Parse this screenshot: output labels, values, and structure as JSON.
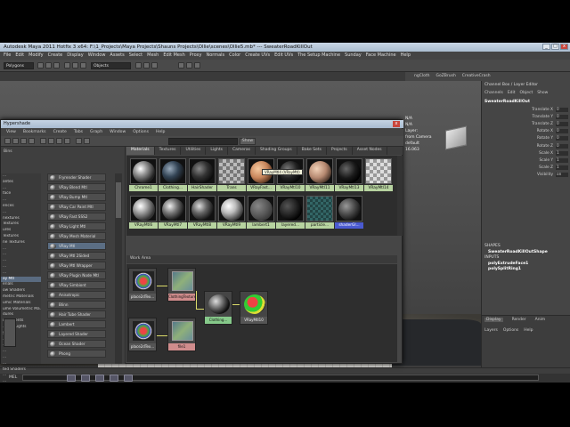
{
  "window": {
    "title": "Autodesk Maya 2011 Hotfix 3 x64: F:\\1_Projects\\Maya Projects\\Shauns Projects\\Ollie\\scenes\\Ollie5.mb* --- SweaterRoadKillOut",
    "buttons": [
      "_",
      "□",
      "x"
    ]
  },
  "menubar": [
    "File",
    "Edit",
    "Modify",
    "Create",
    "Display",
    "Window",
    "Assets",
    "Select",
    "Mesh",
    "Edit Mesh",
    "Proxy",
    "Normals",
    "Color",
    "Create UVs",
    "Edit UVs",
    "The Setup Machine",
    "Sunday",
    "Face Machine",
    "Help"
  ],
  "shelf": {
    "mode": "Polygons",
    "field": "Objects"
  },
  "shelf_tabs": [
    "ngCloth",
    "GoZBrush",
    "CreativeCrash"
  ],
  "viewport": {
    "info_lines": [
      "N/A",
      "N/A",
      "Layer:",
      "from Camera",
      "default",
      "16.063"
    ]
  },
  "channel_box": {
    "header": "Channel Box / Layer Editor",
    "tabs": [
      "Channels",
      "Edit",
      "Object",
      "Show"
    ],
    "object": "SweaterRoadKillOut",
    "attributes": [
      "Translate X",
      "Translate Y",
      "Translate Z",
      "Rotate X",
      "Rotate Y",
      "Rotate Z",
      "Scale X",
      "Scale Y",
      "Scale Z",
      "Visibility"
    ],
    "values": [
      "0",
      "0",
      "0",
      "0",
      "0",
      "0",
      "1",
      "1",
      "1",
      "on"
    ],
    "shapes_label": "SHAPES",
    "shape_name": "SweaterRoadKillOutShape",
    "inputs_label": "INPUTS",
    "inputs": [
      "polyExtrudeFace1",
      "polySplitRing1"
    ]
  },
  "layer_editor": {
    "tabs": [
      "Display",
      "Render",
      "Anim"
    ],
    "menu": [
      "Layers",
      "Options",
      "Help"
    ]
  },
  "command_line": {
    "label": "MEL"
  },
  "hypershade": {
    "title": "Hypershade",
    "menu": [
      "View",
      "Bookmarks",
      "Create",
      "Tabs",
      "Graph",
      "Window",
      "Options",
      "Help"
    ],
    "show_button": "Show",
    "bins_label": "Bins",
    "tree": [
      "...",
      "antes",
      "...",
      "face",
      "...",
      "ences",
      "...",
      "nextures",
      "Textures",
      "ures",
      "Textures",
      "ne Textures",
      "...",
      "...",
      "...",
      "...",
      "...",
      "ay Mtl",
      "erials",
      "ow Shaders",
      "metric Materials",
      "umic Materials",
      "ume Volumetric Ma...",
      "dures",
      "irronments",
      "...Ray Lights",
      "y Maps",
      "...",
      "...",
      "...",
      "...",
      "...",
      "ted Shaders",
      "...",
      "...",
      "ture Contrast",
      "...",
      "...",
      "ture Output",
      "...",
      "iple Compositing"
    ],
    "tree_selected_index": 17,
    "nodes": [
      "Fryrender Shader",
      "VRay Blend Mtl",
      "VRay Bump Mtl",
      "VRay Car Paint Mtl",
      "VRay Fast SSS2",
      "VRay Light Mtl",
      "VRay Mesh Material",
      "VRay Mtl",
      "VRay Mtl 2Sided",
      "VRay Mtl Wrapper",
      "VRay Plugin Node Mtl",
      "VRay Simbiont",
      "Anisotropic",
      "Blinn",
      "Hair Tube Shader",
      "Lambert",
      "Layered Shader",
      "Ocean Shader",
      "Phong"
    ],
    "nodes_highlight_index": 7,
    "tabs": [
      "Materials",
      "Textures",
      "Utilities",
      "Lights",
      "Cameras",
      "Shading Groups",
      "Bake Sets",
      "Projects",
      "Asset Nodes"
    ],
    "active_tab": 0,
    "materials_row1": [
      "Chrome1",
      "Clothing...",
      "HairShader",
      "Trans",
      "VRayFast...",
      "VRayMtl10",
      "VRayMtl11",
      "VRayMtl13",
      "VRayMtl14"
    ],
    "materials_row2": [
      "VRayMtl6",
      "VRayMtl7",
      "VRayMtl8",
      "VRayMtl9",
      "lambert1",
      "layered...",
      "particle...",
      "shaderGl..."
    ],
    "tooltip": "VRayMtl4 (VRayMtl)",
    "work_area_label": "Work Area",
    "graph_nodes": [
      "place2dTex...",
      "ClothingTexture",
      "Clothing...",
      "VRayMtl10",
      "place2dTex...",
      "file1"
    ]
  },
  "colors": {
    "material_label": "#b7d3a0",
    "selected_label": "#4a5ad0",
    "texture_label": "#d08c8c",
    "shader_label": "#86c98a",
    "connection": "#dcdc6a"
  }
}
